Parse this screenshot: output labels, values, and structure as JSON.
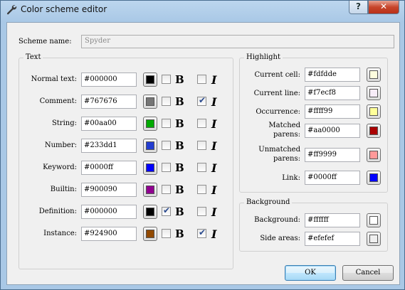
{
  "window": {
    "title": "Color scheme editor",
    "help": "?",
    "close": "✕"
  },
  "scheme": {
    "label": "Scheme name:",
    "value": "Spyder"
  },
  "text_group": {
    "title": "Text",
    "bold_label": "B",
    "italic_label": "I",
    "rows": [
      {
        "label": "Normal text:",
        "value": "#000000",
        "color": "#000000",
        "bold": false,
        "italic": false
      },
      {
        "label": "Comment:",
        "value": "#767676",
        "color": "#767676",
        "bold": false,
        "italic": true
      },
      {
        "label": "String:",
        "value": "#00aa00",
        "color": "#00aa00",
        "bold": false,
        "italic": false
      },
      {
        "label": "Number:",
        "value": "#233dd1",
        "color": "#233dd1",
        "bold": false,
        "italic": false
      },
      {
        "label": "Keyword:",
        "value": "#0000ff",
        "color": "#0000ff",
        "bold": false,
        "italic": false
      },
      {
        "label": "Builtin:",
        "value": "#900090",
        "color": "#900090",
        "bold": false,
        "italic": false
      },
      {
        "label": "Definition:",
        "value": "#000000",
        "color": "#000000",
        "bold": true,
        "italic": false
      },
      {
        "label": "Instance:",
        "value": "#924900",
        "color": "#924900",
        "bold": false,
        "italic": true
      }
    ]
  },
  "highlight_group": {
    "title": "Highlight",
    "rows": [
      {
        "label": "Current cell:",
        "value": "#fdfdde",
        "color": "#fdfdde"
      },
      {
        "label": "Current line:",
        "value": "#f7ecf8",
        "color": "#f7ecf8"
      },
      {
        "label": "Occurrence:",
        "value": "#ffff99",
        "color": "#ffff99"
      },
      {
        "label": "Matched\nparens:",
        "value": "#aa0000",
        "color": "#aa0000"
      },
      {
        "label": "Unmatched\nparens:",
        "value": "#ff9999",
        "color": "#ff9999"
      },
      {
        "label": "Link:",
        "value": "#0000ff",
        "color": "#0000ff"
      }
    ]
  },
  "background_group": {
    "title": "Background",
    "rows": [
      {
        "label": "Background:",
        "value": "#ffffff",
        "color": "#ffffff"
      },
      {
        "label": "Side areas:",
        "value": "#efefef",
        "color": "#efefef"
      }
    ]
  },
  "buttons": {
    "ok": "OK",
    "cancel": "Cancel"
  }
}
